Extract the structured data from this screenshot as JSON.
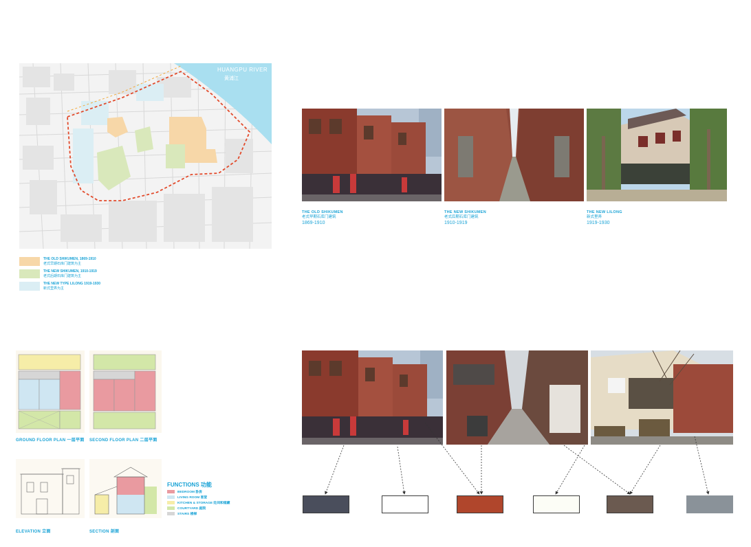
{
  "map": {
    "river_label": "HUANGPU RIVER",
    "river_label_cn": "黄浦江"
  },
  "legend": [
    {
      "color": "#f7d7a8",
      "title": "THE OLD SHIKUMEN, 1869-1910",
      "cn": "老式早期石库门建筑为主"
    },
    {
      "color": "#d9e8bb",
      "title": "THE NEW SHIKUMEN, 1910-1919",
      "cn": "老式后期石库门建筑为主"
    },
    {
      "color": "#dbeef4",
      "title": "THE NEW TYPE LILONG 1919-1930",
      "cn": "新式里弄为主"
    }
  ],
  "photos_top": [
    {
      "en": "THE OLD SHIKUMEN",
      "cn": "老式早期石库门建筑",
      "years": "1869-1910"
    },
    {
      "en": "THE NEW SHIKUMEN",
      "cn": "老式后期石库门建筑",
      "years": "1910-1919"
    },
    {
      "en": "THE NEW LILONG",
      "cn": "新式里弄",
      "years": "1919-1930"
    }
  ],
  "swatches": [
    "#4a4e5c",
    "#ffffff",
    "#b0462c",
    "#fcfdf6",
    "#6b5a50",
    "#8a9299"
  ],
  "plans": {
    "ground": "GROUND FLOOR PLAN 一层平面",
    "second": "SECOND FLOOR PLAN 二层平面",
    "elevation": "ELEVATION 立面",
    "section": "SECTION 剖面"
  },
  "functions": {
    "title": "FUNCTIONS 功能",
    "items": [
      {
        "color": "#e99aa0",
        "label": "BEDROOM 卧房"
      },
      {
        "color": "#cfe6f2",
        "label": "LIVING ROOM 客堂"
      },
      {
        "color": "#f6eda8",
        "label": "KITCHEN & STORAGE 灶间和储藏"
      },
      {
        "color": "#d3e7a8",
        "label": "COURTYARD 庭院"
      },
      {
        "color": "#d6d6d6",
        "label": "STAIRS 楼梯"
      }
    ]
  }
}
